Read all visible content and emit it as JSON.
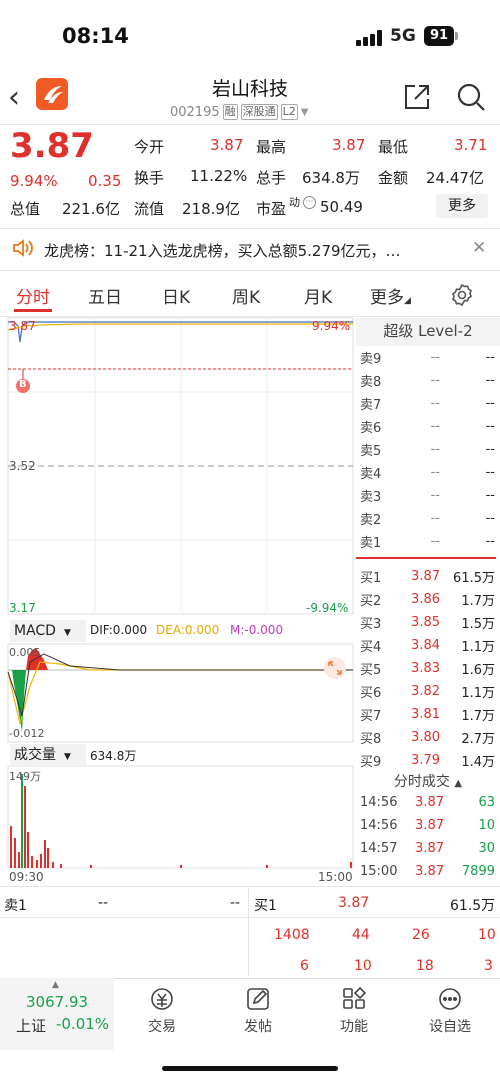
{
  "status": {
    "time": "08:14",
    "network": "5G",
    "battery": "91"
  },
  "header": {
    "title": "岩山科技",
    "code": "002195",
    "tags": [
      "融",
      "深股通",
      "L2"
    ]
  },
  "quote": {
    "price": "3.87",
    "pct": "9.94%",
    "chg": "0.35",
    "fields": [
      {
        "label": "今开",
        "value": "3.87"
      },
      {
        "label": "最高",
        "value": "3.87"
      },
      {
        "label": "最低",
        "value": "3.71"
      },
      {
        "label": "换手",
        "value": "11.22%"
      },
      {
        "label": "总手",
        "value": "634.8万"
      },
      {
        "label": "金额",
        "value": "24.47亿"
      },
      {
        "label": "总值",
        "value": "221.6亿"
      },
      {
        "label": "流值",
        "value": "218.9亿"
      },
      {
        "label": "市盈",
        "value": "50.49"
      }
    ],
    "pe_sup": "动",
    "more": "更多"
  },
  "notice": {
    "text": "龙虎榜：11-21入选龙虎榜，买入总额5.279亿元，…"
  },
  "tabs": [
    "分时",
    "五日",
    "日K",
    "周K",
    "月K",
    "更多"
  ],
  "chart": {
    "price_top": "3.87",
    "pct_top": "9.94%",
    "price_mid": "3.52",
    "price_bottom": "3.17",
    "pct_bottom": "-9.94%",
    "marker": "B",
    "macd_label": "MACD",
    "dif": "DIF:0.000",
    "dea": "DEA:0.000",
    "m": "M:-0.000",
    "macd_top": "0.005",
    "macd_bottom": "-0.012",
    "vol_label": "成交量",
    "vol_value": "634.8万",
    "vol_max": "149万",
    "time_start": "09:30",
    "time_end": "15:00",
    "colors": {
      "up": "#e0302b",
      "down": "#19a14a",
      "price_line": "#3a6fc4",
      "avg_line": "#f2b705"
    }
  },
  "orderbook": {
    "title": "超级 Level-2",
    "asks": [
      {
        "name": "卖9",
        "price": "--",
        "vol": "--"
      },
      {
        "name": "卖8",
        "price": "--",
        "vol": "--"
      },
      {
        "name": "卖7",
        "price": "--",
        "vol": "--"
      },
      {
        "name": "卖6",
        "price": "--",
        "vol": "--"
      },
      {
        "name": "卖5",
        "price": "--",
        "vol": "--"
      },
      {
        "name": "卖4",
        "price": "--",
        "vol": "--"
      },
      {
        "name": "卖3",
        "price": "--",
        "vol": "--"
      },
      {
        "name": "卖2",
        "price": "--",
        "vol": "--"
      },
      {
        "name": "卖1",
        "price": "--",
        "vol": "--"
      }
    ],
    "bids": [
      {
        "name": "买1",
        "price": "3.87",
        "vol": "61.5万"
      },
      {
        "name": "买2",
        "price": "3.86",
        "vol": "1.7万"
      },
      {
        "name": "买3",
        "price": "3.85",
        "vol": "1.5万"
      },
      {
        "name": "买4",
        "price": "3.84",
        "vol": "1.1万"
      },
      {
        "name": "买5",
        "price": "3.83",
        "vol": "1.6万"
      },
      {
        "name": "买6",
        "price": "3.82",
        "vol": "1.1万"
      },
      {
        "name": "买7",
        "price": "3.81",
        "vol": "1.7万"
      },
      {
        "name": "买8",
        "price": "3.80",
        "vol": "2.7万"
      },
      {
        "name": "买9",
        "price": "3.79",
        "vol": "1.4万"
      }
    ],
    "trades_title": "分时成交",
    "trades": [
      {
        "time": "14:56",
        "price": "3.87",
        "vol": "63"
      },
      {
        "time": "14:56",
        "price": "3.87",
        "vol": "10"
      },
      {
        "time": "14:57",
        "price": "3.87",
        "vol": "30"
      },
      {
        "time": "15:00",
        "price": "3.87",
        "vol": "7899"
      }
    ]
  },
  "bottom": {
    "sell1": {
      "label": "卖1",
      "price": "--",
      "vol": "--"
    },
    "buy1": {
      "label": "买1",
      "price": "3.87",
      "vol": "61.5万"
    },
    "queue_row1": [
      "1408",
      "44",
      "26",
      "10"
    ],
    "queue_row2": [
      "6",
      "10",
      "18",
      "3"
    ]
  },
  "nav": {
    "index_value": "3067.93",
    "index_name": "上证",
    "index_pct": "-0.01%",
    "items": [
      "交易",
      "发帖",
      "功能",
      "设自选"
    ]
  }
}
